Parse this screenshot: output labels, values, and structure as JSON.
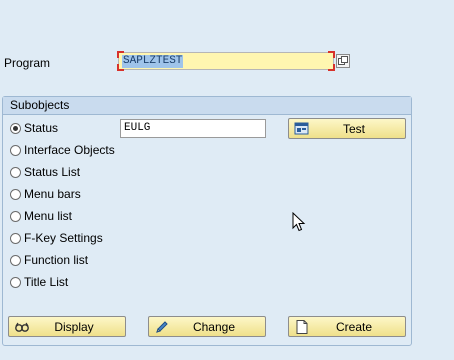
{
  "program": {
    "label": "Program",
    "value": "SAPLZTEST"
  },
  "subobjects": {
    "title": "Subobjects",
    "options": [
      {
        "label": "Status",
        "checked": true
      },
      {
        "label": "Interface Objects",
        "checked": false
      },
      {
        "label": "Status List",
        "checked": false
      },
      {
        "label": "Menu bars",
        "checked": false
      },
      {
        "label": "Menu list",
        "checked": false
      },
      {
        "label": "F-Key Settings",
        "checked": false
      },
      {
        "label": "Function list",
        "checked": false
      },
      {
        "label": "Title List",
        "checked": false
      }
    ],
    "status_value": "EULG",
    "test_label": "Test"
  },
  "actions": {
    "display": "Display",
    "change": "Change",
    "create": "Create"
  },
  "icons": [
    "copy-icon",
    "test-icon",
    "display-icon",
    "change-pencil-icon",
    "create-document-icon",
    "mouse-cursor-icon"
  ]
}
